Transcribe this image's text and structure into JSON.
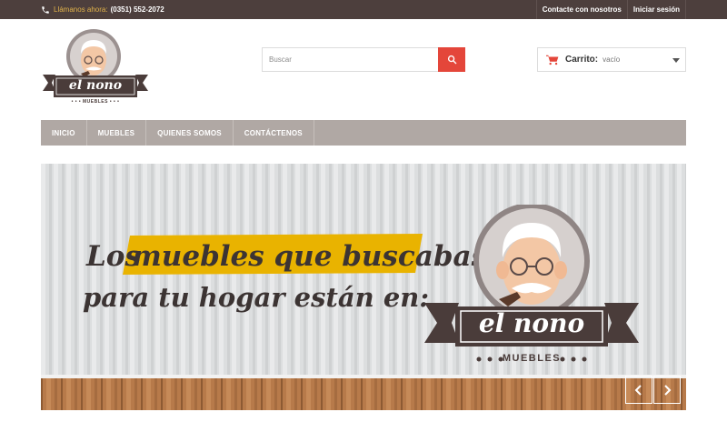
{
  "topbar": {
    "call_label": "Llámanos ahora:",
    "phone": "(0351) 552-2072",
    "links": [
      "Contacte con nosotros",
      "Iniciar sesión"
    ]
  },
  "logo": {
    "name": "el nono",
    "subtitle": "• • • MUEBLES • • •"
  },
  "search": {
    "placeholder": "Buscar",
    "value": ""
  },
  "cart": {
    "label": "Carrito:",
    "status": "vacío"
  },
  "nav": {
    "items": [
      "INICIO",
      "MUEBLES",
      "QUIENES SOMOS",
      "CONTÁCTENOS"
    ]
  },
  "banner": {
    "line1_word": "Los",
    "line1_highlight": "muebles que buscabas",
    "line2": "para tu hogar están en:",
    "logo_name": "el nono",
    "logo_subtitle": "MUEBLES"
  },
  "colors": {
    "topbar": "#4d3f3d",
    "accent_red": "#e4463a",
    "nav": "#b0a8a4",
    "highlight_yellow": "#e9b300",
    "brand_brown": "#4a3c3a"
  }
}
